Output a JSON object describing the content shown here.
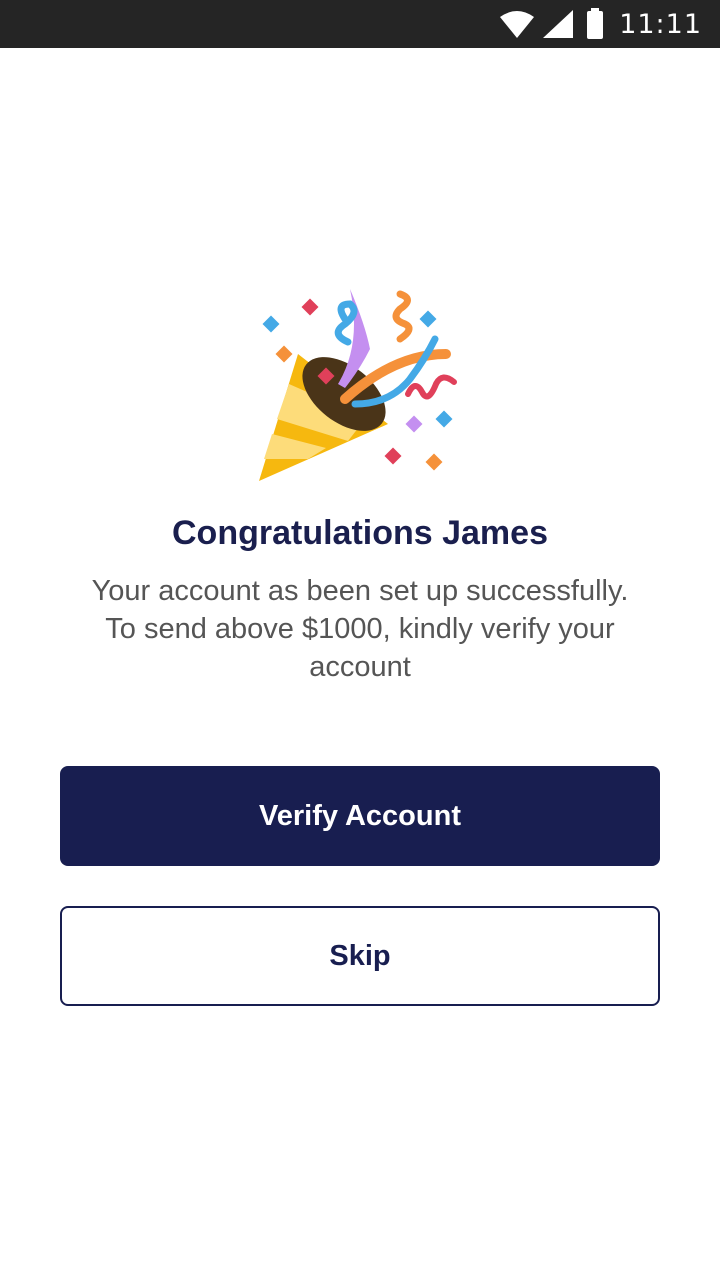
{
  "status_bar": {
    "time": "11:11",
    "icons": [
      "wifi-icon",
      "cellular-signal-icon",
      "battery-icon"
    ]
  },
  "hero": {
    "icon": "party-popper-icon"
  },
  "content": {
    "title": "Congratulations James",
    "message_lines": [
      "Your account as been set up successfully.",
      "To send above $1000, kindly verify your",
      "account"
    ]
  },
  "actions": {
    "verify_label": "Verify Account",
    "skip_label": "Skip"
  },
  "colors": {
    "primary": "#181e50",
    "status_bar": "#252525",
    "body_text": "#555555"
  }
}
